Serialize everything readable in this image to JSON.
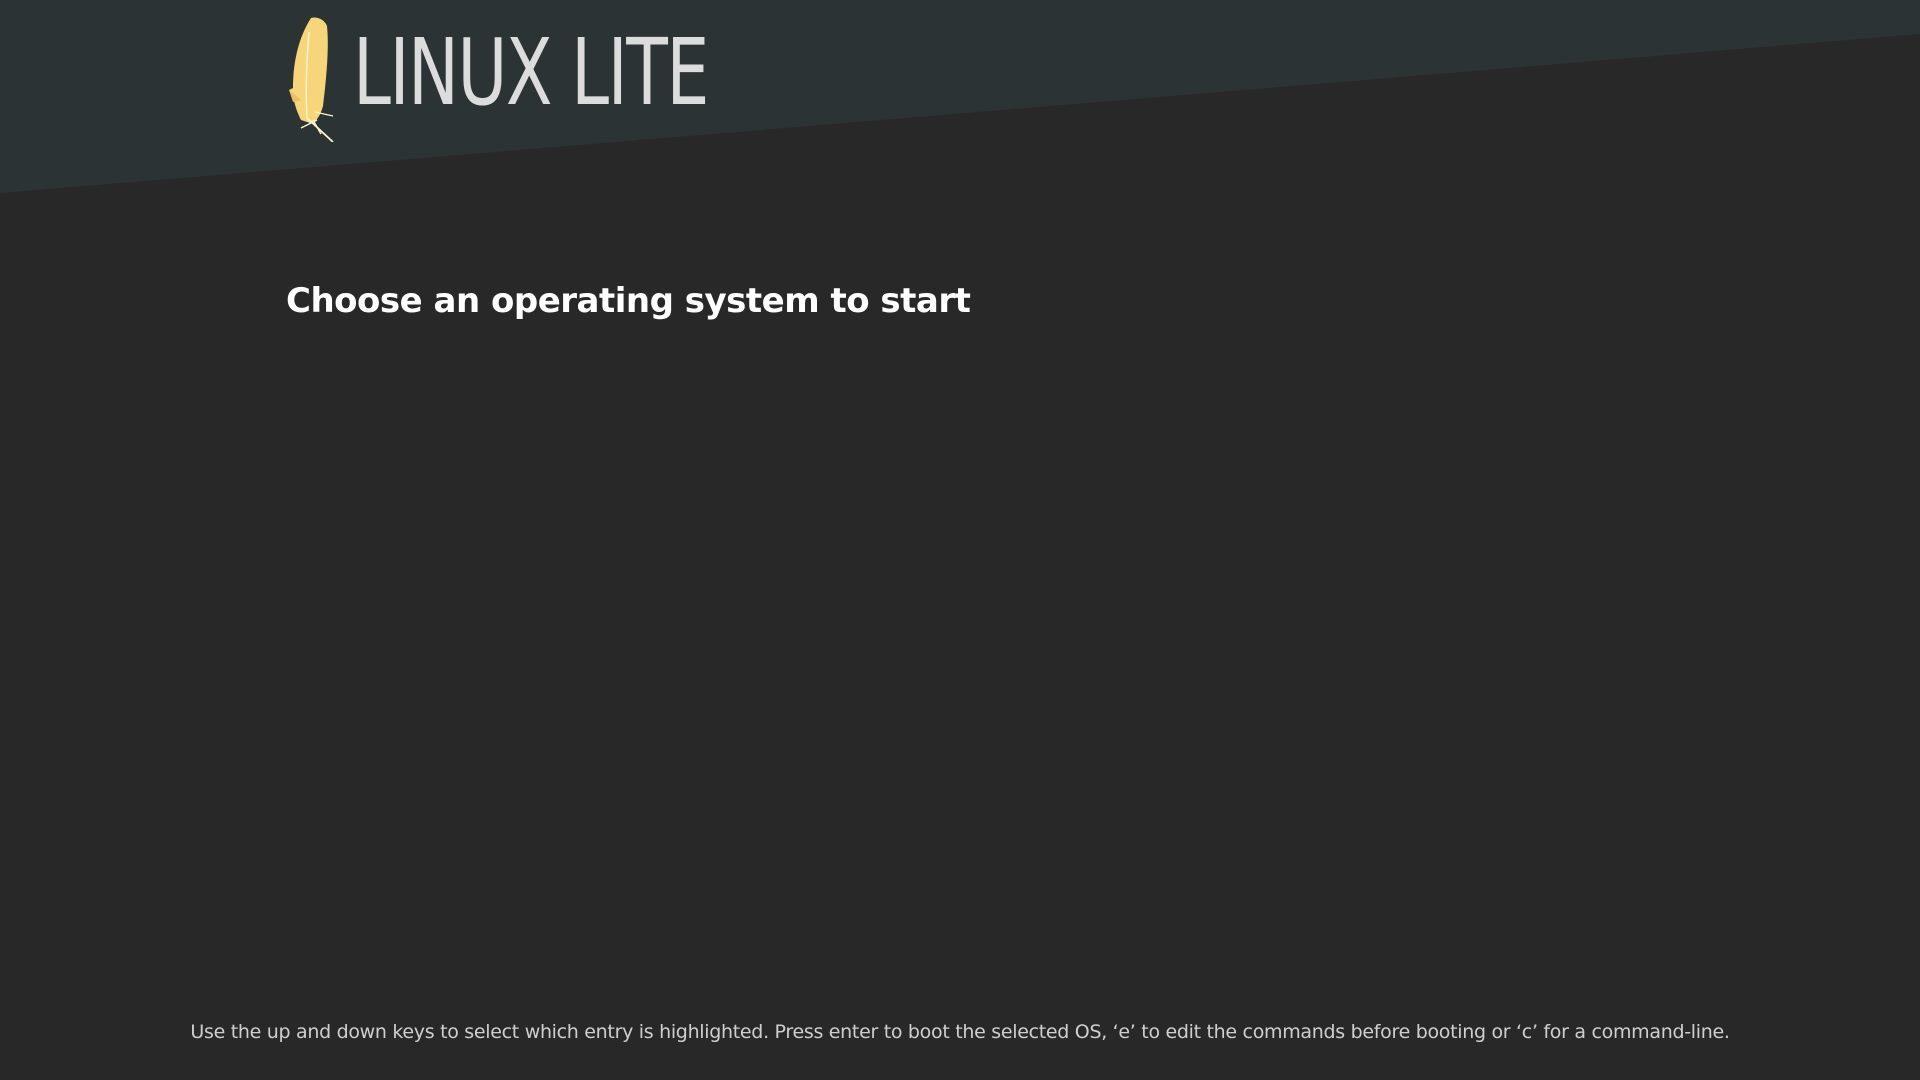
{
  "header": {
    "brand_name": "LINUX LITE",
    "logo_icon": "feather-icon",
    "band_color": "#2c3335"
  },
  "main": {
    "title": "Choose an operating system to start",
    "menu_entries": []
  },
  "footer": {
    "help_text": "Use the up and down keys to select which entry is highlighted. Press enter to boot the selected OS, ‘e’ to edit the commands before booting or ‘c’ for a command-line."
  },
  "colors": {
    "background": "#282828",
    "title": "#ffffff",
    "help_text": "#cfcfcf",
    "logo_text": "#dcdcdc",
    "feather": "#f7d57a"
  }
}
